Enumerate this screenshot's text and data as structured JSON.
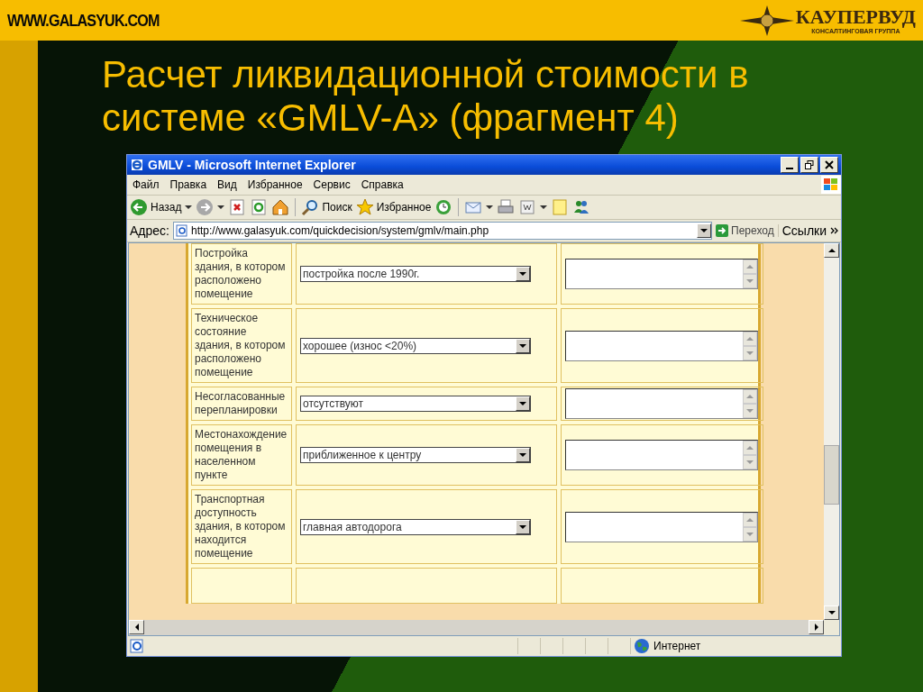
{
  "site": "WWW.GALASYUK.COM",
  "logo": {
    "name": "КАУПЕРВУД",
    "tagline": "КОНСАЛТИНГОВАЯ ГРУППА"
  },
  "slide_title": "Расчет ликвидационной стоимости в системе «GMLV-A» (фрагмент 4)",
  "browser": {
    "title": "GMLV - Microsoft Internet Explorer",
    "menu": [
      "Файл",
      "Правка",
      "Вид",
      "Избранное",
      "Сервис",
      "Справка"
    ],
    "toolbar": [
      {
        "kind": "back",
        "label": "Назад"
      },
      {
        "kind": "forward"
      },
      {
        "kind": "stop"
      },
      {
        "kind": "refresh"
      },
      {
        "kind": "home"
      },
      {
        "kind": "search",
        "label": "Поиск"
      },
      {
        "kind": "favorites",
        "label": "Избранное"
      },
      {
        "kind": "history"
      },
      {
        "kind": "mail"
      },
      {
        "kind": "print"
      },
      {
        "kind": "edit"
      },
      {
        "kind": "note"
      },
      {
        "kind": "messenger"
      }
    ],
    "address_label": "Адрес:",
    "url": "http://www.galasyuk.com/quickdecision/system/gmlv/main.php",
    "go": "Переход",
    "links": "Ссылки",
    "rows": [
      {
        "label": "Постройка здания, в котором расположено помещение",
        "value": "постройка после 1990г."
      },
      {
        "label": "Техническое состояние здания, в котором расположено помещение",
        "value": "хорошее (износ <20%)"
      },
      {
        "label": "Несогласованные перепланировки",
        "value": "отсутствуют"
      },
      {
        "label": "Местонахождение помещения в населенном пункте",
        "value": "приближенное к центру"
      },
      {
        "label": "Транспортная доступность здания, в котором находится помещение",
        "value": "главная автодорога"
      }
    ],
    "status": "Интернет"
  }
}
